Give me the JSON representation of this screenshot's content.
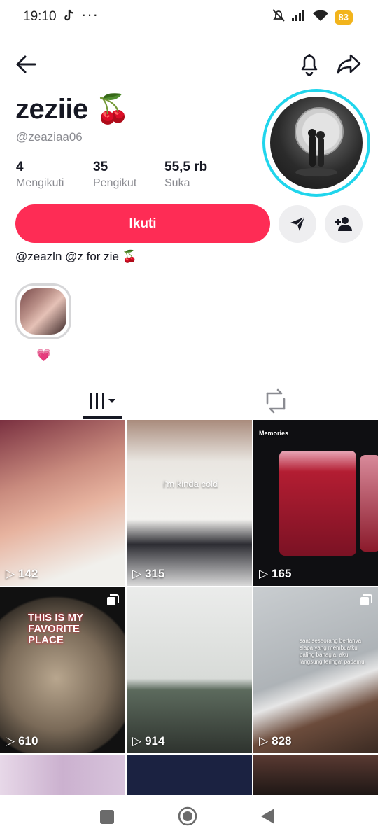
{
  "status": {
    "time": "19:10",
    "more": "···",
    "battery": "83"
  },
  "profile": {
    "display_name": "zeziie 🍒",
    "handle": "@zeaziaa06",
    "stats": [
      {
        "value": "4",
        "label": "Mengikuti"
      },
      {
        "value": "35",
        "label": "Pengikut"
      },
      {
        "value": "55,5 rb",
        "label": "Suka"
      }
    ],
    "follow_label": "Ikuti",
    "bio": "@zeazln @z for zie 🍒",
    "highlight_label": "💗"
  },
  "videos": [
    {
      "views": "142",
      "caption": ""
    },
    {
      "views": "315",
      "caption": "i'm kinda cold"
    },
    {
      "views": "165",
      "caption": "Memories"
    },
    {
      "views": "610",
      "caption": "THIS IS MY FAVORITE PLACE"
    },
    {
      "views": "914",
      "caption": ""
    },
    {
      "views": "828",
      "caption": "saat seseorang bertanya siapa yang membuatku paling bahagia, aku langsung teringat padamu."
    }
  ],
  "colors": {
    "accent": "#fe2c55",
    "ring": "#20d5ec",
    "battery": "#f2b41c"
  }
}
